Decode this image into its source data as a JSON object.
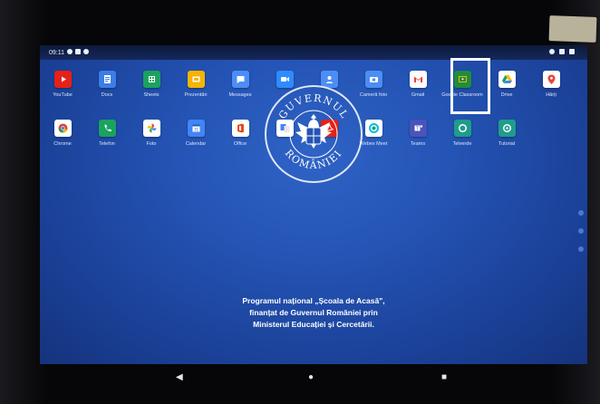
{
  "status_bar": {
    "time": "09:11"
  },
  "apps_row1": [
    {
      "label": "YouTube",
      "color": "#e62117",
      "icon": "youtube-icon"
    },
    {
      "label": "Docs",
      "color": "#3b7de9",
      "icon": "docs-icon"
    },
    {
      "label": "Sheets",
      "color": "#1aa260",
      "icon": "sheets-icon"
    },
    {
      "label": "Prezentări",
      "color": "#f4b400",
      "icon": "slides-icon"
    },
    {
      "label": "Messages",
      "color": "#4c8df6",
      "icon": "messages-icon"
    },
    {
      "label": "",
      "color": "#2d8cff",
      "icon": "zoom-icon"
    },
    {
      "label": "",
      "color": "#4c8df6",
      "icon": "contacts-icon"
    },
    {
      "label": "Cameră foto",
      "color": "#4c8df6",
      "icon": "camera-icon"
    },
    {
      "label": "Gmail",
      "color": "#ffffff",
      "icon": "gmail-icon"
    },
    {
      "label": "Google Classroom",
      "color": "#1e8e3e",
      "icon": "classroom-icon"
    },
    {
      "label": "Drive",
      "color": "#ffffff",
      "icon": "drive-icon"
    },
    {
      "label": "Hărți",
      "color": "#ffffff",
      "icon": "maps-icon"
    }
  ],
  "apps_row2": [
    {
      "label": "Chrome",
      "color": "#ffffff",
      "icon": "chrome-icon"
    },
    {
      "label": "Telefon",
      "color": "#1aa260",
      "icon": "phone-icon"
    },
    {
      "label": "Foto",
      "color": "#ffffff",
      "icon": "photos-icon"
    },
    {
      "label": "Calendar",
      "color": "#4285f4",
      "icon": "calendar-icon"
    },
    {
      "label": "Office",
      "color": "#ffffff",
      "icon": "office-icon"
    },
    {
      "label": "",
      "color": "#ffffff",
      "icon": "translate-icon"
    },
    {
      "label": "",
      "color": "#e62117",
      "icon": "pdf-icon"
    },
    {
      "label": "Webex Meet",
      "color": "#ffffff",
      "icon": "webex-icon"
    },
    {
      "label": "Teams",
      "color": "#4b53bc",
      "icon": "teams-icon"
    },
    {
      "label": "Telverde",
      "color": "#1f9c8c",
      "icon": "telverde-icon"
    },
    {
      "label": "Tutorial",
      "color": "#1f9c8c",
      "icon": "tutorial-icon"
    }
  ],
  "emblem": {
    "top_text": "GUVERNUL",
    "bottom_text": "ROMÂNIEI"
  },
  "program_text": [
    "Programul național „Școala de Acasă\",",
    "finanțat de Guvernul României prin",
    "Ministerul Educației și Cercetării."
  ],
  "nav": {
    "back": "◀",
    "home": "●",
    "recents": "■"
  },
  "colors": {
    "accent": "#2454b5",
    "highlight": "#ffffff"
  }
}
